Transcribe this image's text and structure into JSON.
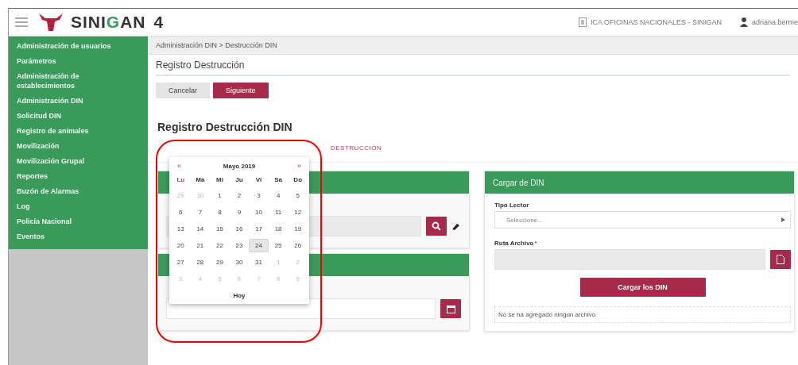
{
  "header": {
    "app_name_start": "SINI",
    "app_name_accent": "G",
    "app_name_end": "AN",
    "version": "4",
    "office": "ICA OFICINAS NACIONALES - SINIGAN",
    "user": "adriana.berme"
  },
  "sidebar": {
    "items": [
      {
        "label": "Administración de usuarios"
      },
      {
        "label": "Parámetros"
      },
      {
        "label": "Administración de establecimientos"
      },
      {
        "label": "Administración DIN"
      },
      {
        "label": "Solicitud DIN"
      },
      {
        "label": "Registro de animales"
      },
      {
        "label": "Movilización"
      },
      {
        "label": "Movilización Grupal"
      },
      {
        "label": "Reportes"
      },
      {
        "label": "Buzón de Alarmas"
      },
      {
        "label": "Log"
      },
      {
        "label": "Policía Nacional"
      },
      {
        "label": "Eventos"
      }
    ]
  },
  "breadcrumb": "Administración DIN > Destrucción DIN",
  "page_title": "Registro Destrucción",
  "buttons": [
    {
      "label": "Cancelar",
      "kind": "secondary"
    },
    {
      "label": "Siguiente",
      "kind": "primary"
    }
  ],
  "section_title": "Registro Destrucción DIN",
  "tabs": [
    {
      "label": "DESTRUCCIÓN",
      "selected": false
    }
  ],
  "datepicker": {
    "prev": "«",
    "month": "Mayo 2019",
    "next": "»",
    "weekdays": [
      "Lu",
      "Ma",
      "Mi",
      "Ju",
      "Vi",
      "Sa",
      "Do"
    ],
    "weeks": [
      [
        {
          "day": "29",
          "outside": true,
          "selected": false
        },
        {
          "day": "30",
          "outside": true,
          "selected": false
        },
        {
          "day": "1",
          "outside": false,
          "selected": false
        },
        {
          "day": "2",
          "outside": false,
          "selected": false
        },
        {
          "day": "3",
          "outside": false,
          "selected": false
        },
        {
          "day": "4",
          "outside": false,
          "selected": false
        },
        {
          "day": "5",
          "outside": false,
          "selected": false
        }
      ],
      [
        {
          "day": "6",
          "outside": false,
          "selected": false
        },
        {
          "day": "7",
          "outside": false,
          "selected": false
        },
        {
          "day": "8",
          "outside": false,
          "selected": false
        },
        {
          "day": "9",
          "outside": false,
          "selected": false
        },
        {
          "day": "10",
          "outside": false,
          "selected": false
        },
        {
          "day": "11",
          "outside": false,
          "selected": false
        },
        {
          "day": "12",
          "outside": false,
          "selected": false
        }
      ],
      [
        {
          "day": "13",
          "outside": false,
          "selected": false
        },
        {
          "day": "14",
          "outside": false,
          "selected": false
        },
        {
          "day": "15",
          "outside": false,
          "selected": false
        },
        {
          "day": "16",
          "outside": false,
          "selected": false
        },
        {
          "day": "17",
          "outside": false,
          "selected": false
        },
        {
          "day": "18",
          "outside": false,
          "selected": false
        },
        {
          "day": "19",
          "outside": false,
          "selected": false
        }
      ],
      [
        {
          "day": "20",
          "outside": false,
          "selected": false
        },
        {
          "day": "21",
          "outside": false,
          "selected": false
        },
        {
          "day": "22",
          "outside": false,
          "selected": false
        },
        {
          "day": "23",
          "outside": false,
          "selected": false
        },
        {
          "day": "24",
          "outside": false,
          "selected": true
        },
        {
          "day": "25",
          "outside": false,
          "selected": false
        },
        {
          "day": "26",
          "outside": false,
          "selected": false
        }
      ],
      [
        {
          "day": "27",
          "outside": false,
          "selected": false
        },
        {
          "day": "28",
          "outside": false,
          "selected": false
        },
        {
          "day": "29",
          "outside": false,
          "selected": false
        },
        {
          "day": "30",
          "outside": false,
          "selected": false
        },
        {
          "day": "31",
          "outside": false,
          "selected": false
        },
        {
          "day": "1",
          "outside": true,
          "selected": false
        },
        {
          "day": "2",
          "outside": true,
          "selected": false
        }
      ],
      [
        {
          "day": "3",
          "outside": true,
          "selected": false
        },
        {
          "day": "4",
          "outside": true,
          "selected": false
        },
        {
          "day": "5",
          "outside": true,
          "selected": false
        },
        {
          "day": "6",
          "outside": true,
          "selected": false
        },
        {
          "day": "7",
          "outside": true,
          "selected": false
        },
        {
          "day": "8",
          "outside": true,
          "selected": false
        },
        {
          "day": "9",
          "outside": true,
          "selected": false
        }
      ]
    ],
    "today": "Hoy"
  },
  "upload_panel": {
    "title": "Cargar de DIN",
    "reader_label": "Tipo Lector",
    "reader_placeholder": "Seleccione...",
    "file_label": "Ruta Archivo",
    "required_mark": "*",
    "upload_button": "Cargar los DIN",
    "status": "No se ha agregado ningún archivo"
  }
}
